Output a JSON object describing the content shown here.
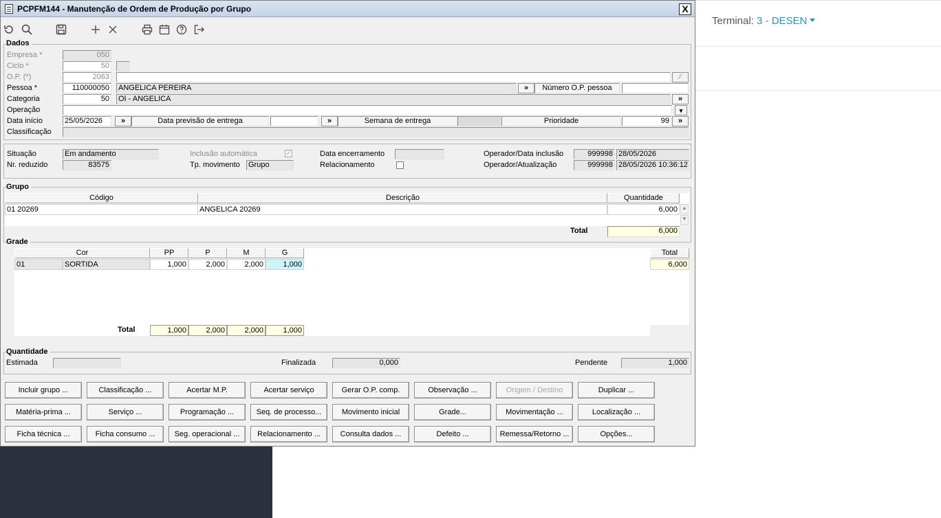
{
  "window": {
    "title": "PCPFM144 - Manutenção de Ordem de Produção por Grupo",
    "close_label": "X"
  },
  "toolbar": {
    "items": [
      "undo-icon",
      "search-icon",
      "save-icon",
      "add-icon",
      "delete-icon",
      "print-icon",
      "calendar-icon",
      "help-icon",
      "exit-icon"
    ]
  },
  "dados": {
    "section_label": "Dados",
    "empresa_label": "Empresa *",
    "empresa_value": "050",
    "ciclo_label": "Ciclo *",
    "ciclo_value": "50",
    "op_label": "O.P. (*)",
    "op_value": "2063",
    "pessoa_label": "Pessoa *",
    "pessoa_code": "110000050",
    "pessoa_name": "ANGELICA PEREIRA",
    "numero_op_pessoa_label": "Número O.P. pessoa",
    "numero_op_pessoa_value": "",
    "categoria_label": "Categoria",
    "categoria_code": "50",
    "categoria_name": "OI - ANGELICA",
    "operacao_label": "Operação",
    "operacao_value": "",
    "data_inicio_label": "Data início",
    "data_inicio_value": "25/05/2026",
    "data_previsao_label": "Data previsão de entrega",
    "data_previsao_value": "",
    "semana_label": "Semana de entrega",
    "semana_value": "",
    "prioridade_label": "Prioridade",
    "prioridade_value": "99",
    "classificacao_label": "Classificação",
    "classificacao_value": "",
    "lookup_symbol": "»"
  },
  "status": {
    "situacao_label": "Situação",
    "situacao_value": "Em andamento",
    "nr_reduzido_label": "Nr. reduzido",
    "nr_reduzido_value": "83575",
    "inclusao_label": "Inclusão automática",
    "tp_movimento_label": "Tp. movimento",
    "tp_movimento_value": "Grupo",
    "data_encerramento_label": "Data encerramento",
    "data_encerramento_value": "",
    "relacionamento_label": "Relacionamento",
    "operador_inclusao_label": "Operador/Data inclusão",
    "operador_inclusao_code": "999998",
    "operador_inclusao_date": "28/05/2026",
    "operador_atualizacao_label": "Operador/Atualização",
    "operador_atualizacao_code": "999998",
    "operador_atualizacao_date": "28/05/2026 10:36:12"
  },
  "grupo": {
    "section_label": "Grupo",
    "headers": {
      "codigo": "Código",
      "descricao": "Descrição",
      "quantidade": "Quantidade"
    },
    "rows": [
      {
        "codigo": "01 20269",
        "descricao": "ANGELICA 20269",
        "quantidade": "6,000"
      }
    ],
    "total_label": "Total",
    "total_value": "6,000"
  },
  "grade": {
    "section_label": "Grade",
    "headers": {
      "cor": "Cor",
      "pp": "PP",
      "p": "P",
      "m": "M",
      "g": "G",
      "total": "Total"
    },
    "rows": [
      {
        "code": "01",
        "cor": "SORTIDA",
        "pp": "1,000",
        "p": "2,000",
        "m": "2,000",
        "g": "1,000",
        "total": "6,000"
      }
    ],
    "total_label": "Total",
    "totals": {
      "pp": "1,000",
      "p": "2,000",
      "m": "2,000",
      "g": "1,000"
    }
  },
  "quantidade": {
    "section_label": "Quantidade",
    "estimada_label": "Estimada",
    "estimada_value": "",
    "finalizada_label": "Finalizada",
    "finalizada_value": "0,000",
    "pendente_label": "Pendente",
    "pendente_value": "1,000"
  },
  "actions": {
    "row1": [
      "Incluir grupo ...",
      "Classificação ...",
      "Acertar M.P.",
      "Acertar serviço",
      "Gerar O.P. comp.",
      "Observação ...",
      "Origem / Destino",
      "Duplicar ..."
    ],
    "row2": [
      "Matéria-prima ...",
      "Serviço ...",
      "Programação ...",
      "Seq. de processo...",
      "Movimento inicial",
      "Grade...",
      "Movimentação ...",
      "Localização ..."
    ],
    "row3": [
      "Ficha técnica ...",
      "Ficha consumo ...",
      "Seg. operacional ...",
      "Relacionamento ...",
      "Consulta dados ...",
      "Defeito ...",
      "Remessa/Retorno ...",
      "Opções..."
    ]
  },
  "terminal": {
    "label": "Terminal:",
    "value": "3 - DESEN"
  }
}
